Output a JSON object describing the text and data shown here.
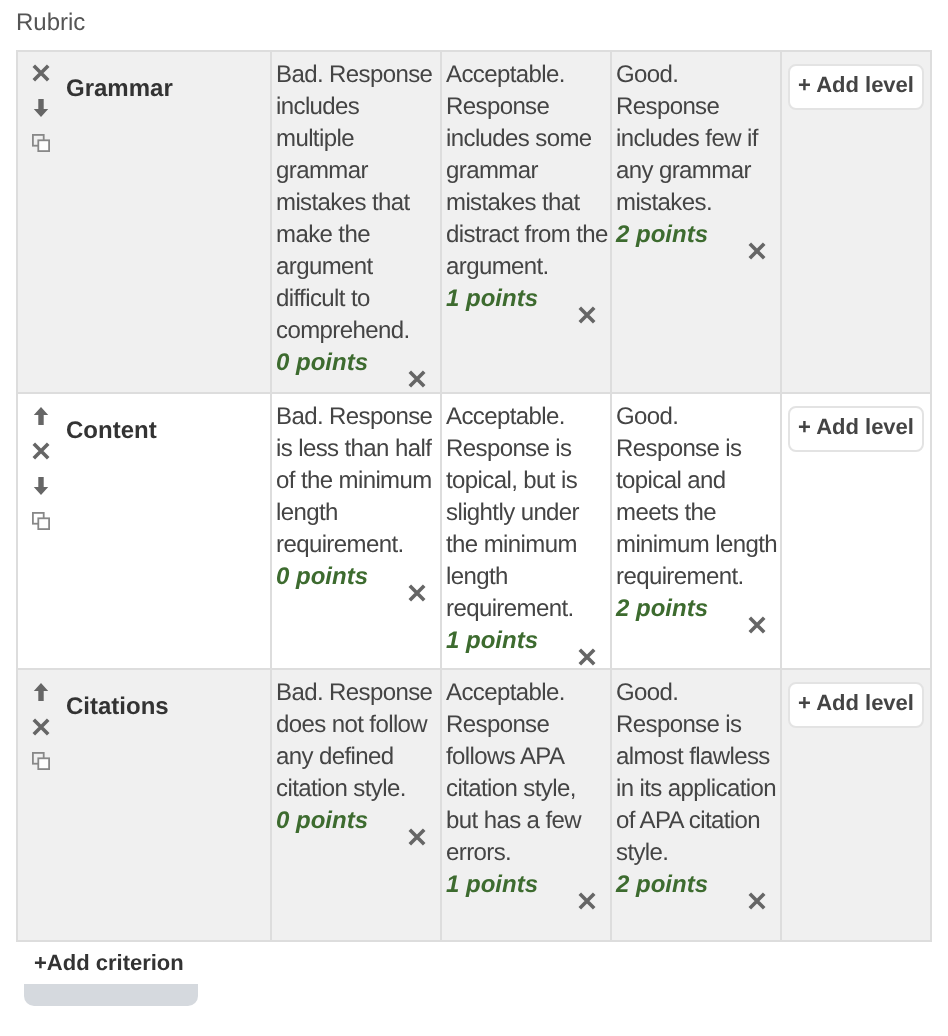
{
  "heading": "Rubric",
  "criteria": [
    {
      "name": "Grammar",
      "actions": [
        {
          "kind": "delete"
        },
        {
          "kind": "down"
        },
        {
          "kind": "duplicate"
        }
      ],
      "levels": [
        {
          "definition": "Bad. Response includes multiple grammar mistakes that make the argument difficult to comprehend.",
          "points": "0 points"
        },
        {
          "definition": "Acceptable. Response includes some grammar mistakes that distract from the argument.",
          "points": "1 points"
        },
        {
          "definition": "Good. Response includes few if any grammar mistakes.",
          "points": "2 points"
        }
      ],
      "add_level": "+ Add level"
    },
    {
      "name": "Content",
      "actions": [
        {
          "kind": "up"
        },
        {
          "kind": "delete"
        },
        {
          "kind": "down"
        },
        {
          "kind": "duplicate"
        }
      ],
      "levels": [
        {
          "definition": "Bad. Response is less than half of the minimum length requirement.",
          "points": "0 points"
        },
        {
          "definition": "Acceptable. Response is topical, but is slightly under the minimum length requirement.",
          "points": "1 points"
        },
        {
          "definition": "Good. Response is topical and meets the minimum length requirement.",
          "points": "2 points"
        }
      ],
      "add_level": "+ Add level"
    },
    {
      "name": "Citations",
      "actions": [
        {
          "kind": "up"
        },
        {
          "kind": "delete"
        },
        {
          "kind": "duplicate"
        }
      ],
      "levels": [
        {
          "definition": "Bad. Response does not follow any defined citation style.",
          "points": "0 points"
        },
        {
          "definition": "Acceptable. Response follows APA citation style, but has a few errors.",
          "points": "1 points"
        },
        {
          "definition": "Good. Response is almost flawless in its application of APA citation style.",
          "points": "2 points"
        }
      ],
      "add_level": "+ Add level"
    }
  ],
  "add_criterion": "+Add criterion"
}
